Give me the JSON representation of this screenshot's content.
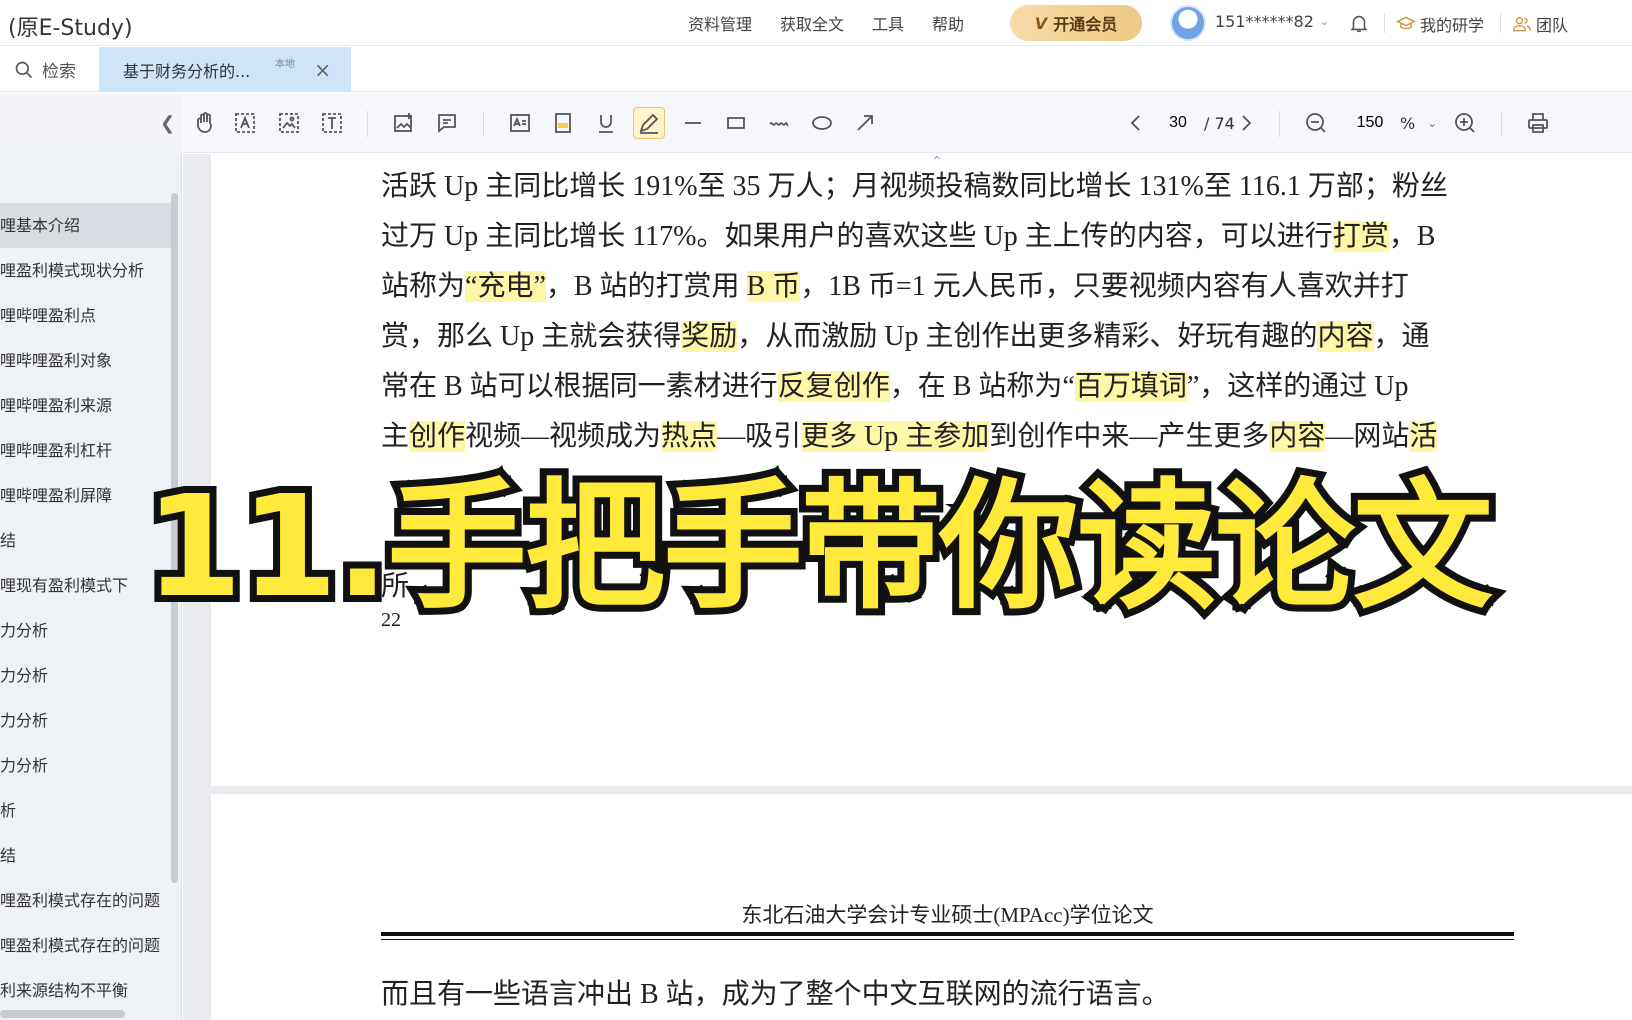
{
  "app": {
    "title": "(原E-Study)"
  },
  "topnav": [
    "资料管理",
    "获取全文",
    "工具",
    "帮助"
  ],
  "vip": {
    "label": "开通会员",
    "badge": "V"
  },
  "user": {
    "name": "151******82"
  },
  "right_links": {
    "research": "我的研学",
    "team": "团队"
  },
  "tabs": {
    "search": "检索",
    "doc_title": "基于财务分析的...",
    "doc_tag": "本地"
  },
  "sidebar": {
    "items": [
      "哩基本介绍",
      "哩盈利模式现状分析",
      "哩哔哩盈利点",
      "哩哔哩盈利对象",
      "哩哔哩盈利来源",
      "哩哔哩盈利杠杆",
      "哩哔哩盈利屏障",
      "结",
      "哩现有盈利模式下",
      "力分析",
      "力分析",
      "力分析",
      "力分析",
      "析",
      "结",
      "哩盈利模式存在的问题",
      "哩盈利模式存在的问题",
      "利来源结构不平衡"
    ]
  },
  "toolbar": {
    "page_current": "30",
    "page_total": "/ 74",
    "zoom": "150",
    "zoom_unit": "%"
  },
  "document": {
    "lines": [
      [
        {
          "t": "活跃 Up 主同比增长 191%至 35 万人；月视频投稿数同比增长 131%至 116.1 万部；粉丝",
          "h": false
        }
      ],
      [
        {
          "t": "过万 Up 主同比增长 117%。如果用户的喜欢这些 Up 主上传的内容，可以进行",
          "h": false
        },
        {
          "t": "打赏",
          "h": true
        },
        {
          "t": "，B",
          "h": false
        }
      ],
      [
        {
          "t": "站称为",
          "h": false
        },
        {
          "t": "“充电”",
          "h": true
        },
        {
          "t": "，B 站的打赏用 ",
          "h": false
        },
        {
          "t": "B 币",
          "h": true
        },
        {
          "t": "，1B 币=1 元人民币，只要视频内容有人喜欢并打",
          "h": false
        }
      ],
      [
        {
          "t": "赏，那么 Up 主就会获得",
          "h": false
        },
        {
          "t": "奖励",
          "h": true
        },
        {
          "t": "，从而激励 Up 主创作出更多精彩、好玩有趣的",
          "h": false
        },
        {
          "t": "内容",
          "h": true
        },
        {
          "t": "，通",
          "h": false
        }
      ],
      [
        {
          "t": "常在 B 站可以根据同一素材进行",
          "h": false
        },
        {
          "t": "反复创作",
          "h": true
        },
        {
          "t": "，在 B 站称为“",
          "h": false
        },
        {
          "t": "百万填词",
          "h": true
        },
        {
          "t": "”，这样的通过 Up",
          "h": false
        }
      ],
      [
        {
          "t": "主",
          "h": false
        },
        {
          "t": "创作",
          "h": true
        },
        {
          "t": "视频—视频成为",
          "h": false
        },
        {
          "t": "热点",
          "h": true
        },
        {
          "t": "—吸引",
          "h": false
        },
        {
          "t": "更多 Up 主参加",
          "h": true
        },
        {
          "t": "到创作中来—产生更多",
          "h": false
        },
        {
          "t": "内容",
          "h": true
        },
        {
          "t": "—网站",
          "h": false
        },
        {
          "t": "活",
          "h": true
        }
      ],
      [
        {
          "t": "",
          "h": false
        }
      ],
      [
        {
          "t": "",
          "h": false
        }
      ],
      [
        {
          "t": "所",
          "h": false
        }
      ]
    ],
    "page_number": "22",
    "header": "东北石油大学会计专业硕士(MPAcc)学位论文",
    "next_para": "而且有一些语言冲出 B 站，成为了整个中文互联网的流行语言。"
  },
  "overlay": {
    "text": "11.手把手带你读论文"
  }
}
